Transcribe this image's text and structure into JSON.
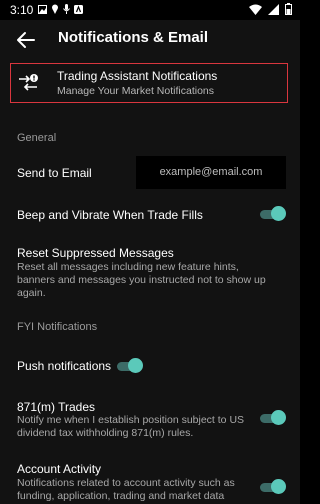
{
  "status_bar": {
    "time": "3:10"
  },
  "header": {
    "title": "Notifications & Email"
  },
  "assistant": {
    "title": "Trading Assistant Notifications",
    "subtitle": "Manage Your Market Notifications"
  },
  "general": {
    "section_label": "General",
    "send_email": {
      "label": "Send to Email",
      "placeholder": "example@email.com"
    },
    "beep": {
      "label": "Beep and Vibrate When Trade Fills",
      "on": true
    },
    "reset": {
      "label": "Reset Suppressed Messages",
      "description": "Reset all messages including new feature hints, banners and messages you instructed not to show up again."
    }
  },
  "fyi": {
    "section_label": "FYI Notifications",
    "push": {
      "label": "Push notifications",
      "on": true
    },
    "trades_871m": {
      "label": "871(m) Trades",
      "description": "Notify me when I establish position subject to US dividend tax withholding 871(m) rules.",
      "on": true
    },
    "account_activity": {
      "label": "Account Activity",
      "description": "Notifications related to account activity such as funding, application, trading and market data",
      "on": true
    }
  },
  "colors": {
    "accent": "#5bc9ba",
    "highlight_border": "#d9363e",
    "background": "#121212"
  }
}
